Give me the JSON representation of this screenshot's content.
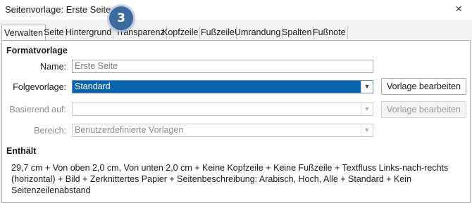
{
  "window": {
    "title": "Seitenvorlage: Erste Seite",
    "close_glyph": "×"
  },
  "tabs": [
    "Verwalten",
    "Seite",
    "Hintergrund",
    "Transparenz",
    "Kopfzeile",
    "Fußzeile",
    "Umrandung",
    "Spalten",
    "Fußnote"
  ],
  "step_badge": "3",
  "formatvorlage": {
    "heading": "Formatvorlage",
    "name_label": "Name:",
    "name_placeholder": "Erste Seite",
    "next_label": "Folgevorlage:",
    "next_value": "Standard",
    "edit_button": "Vorlage bearbeiten",
    "based_label": "Basierend auf:",
    "based_value": "",
    "based_edit_button": "Vorlage bearbeiten",
    "area_label": "Bereich:",
    "area_value": "Benutzerdefinierte Vorlagen"
  },
  "contains": {
    "heading": "Enthält",
    "text": "29,7 cm + Von oben 2,0 cm, Von unten 2,0 cm + Keine Kopfzeile + Keine Fußzeile + Textfluss Links-nach-rechts (horizontal) + Bild + Zerknittertes Papier + Seitenbeschreibung: Arabisch, Hoch, Alle + Standard + Kein Seitenzeilenabstand"
  },
  "icons": {
    "close": "close-icon",
    "dropdown": "chevron-down-icon"
  },
  "colors": {
    "selection": "#0a64ad",
    "badge": "#3b6b9d"
  }
}
